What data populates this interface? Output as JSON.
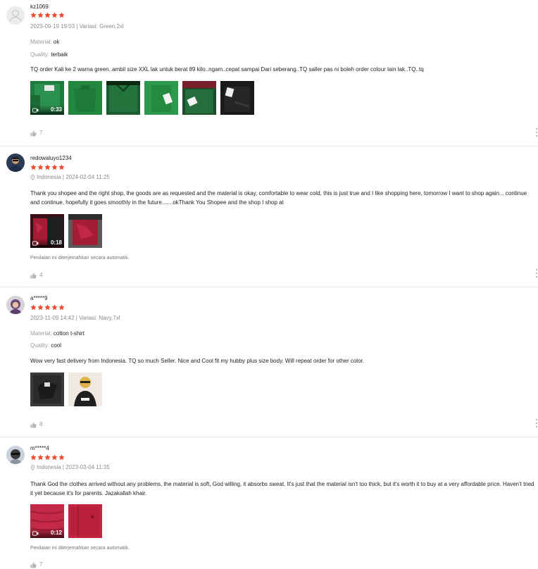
{
  "colors": {
    "star": "#ee4d2d",
    "meta": "#8a8a8a",
    "divider": "#e8e8e8"
  },
  "reviews": [
    {
      "username": "kz1069",
      "rating": 5,
      "meta": "2023-09-19 19:03 | Variasi: Green,2xl",
      "material_label": "Material:",
      "material_value": "ok",
      "quality_label": "Quality:",
      "quality_value": "terbaik",
      "comment": "TQ order Kali ke 2 warna green..ambil size XXL lak untuk berat 89 kilo..ngam..cepat sampai Dari seberang..TQ saller pas ni boleh order colour lain lak..TQ..tq",
      "video_duration": "0:33",
      "likes": "7",
      "avatar_icon": "default-user-icon",
      "media_icon": "video-camera-icon"
    },
    {
      "username": "redowaluyo1234",
      "rating": 5,
      "location": "Indonesia",
      "meta": "Indonesia | 2024-02-04 11:25",
      "comment": "Thank you shopee and the right shop, the goods are as requested and the material is okay, comfortable to wear cold, this is just true and I like shopping here, tomorrow I want to shop again... continue and continue, hopefully it goes smoothly in the future.......okThank You Shopee and the shop I shop at",
      "video_duration": "0:18",
      "translated_note": "Penilaian ini diterjemahkan secara automatik.",
      "likes": "4"
    },
    {
      "username": "a*****9",
      "rating": 5,
      "meta": "2023-11-09 14:42 | Variasi: Navy,7xl",
      "material_label": "Material:",
      "material_value": "cotton t-shirt",
      "quality_label": "Quality:",
      "quality_value": "cool",
      "comment": "Wow very fast delivery from Indonesia. TQ so much Seller. Nice and Cool fit my hubby plus size body. Will repeat order for other color.",
      "likes": "8"
    },
    {
      "username": "m*****4",
      "rating": 5,
      "meta": "Indonesia | 2023-03-04 11:35",
      "comment": "Thank God the clothes arrived without any problems, the material is soft, God willing, it absorbs sweat. It's just that the material isn't too thick, but it's worth it to buy at a very affordable price. Haven't tried it yet because it's for parents. Jazakallah khair.",
      "video_duration": "0:12",
      "translated_note": "Penilaian ini diterjemahkan secara automatik.",
      "likes": "7"
    }
  ]
}
